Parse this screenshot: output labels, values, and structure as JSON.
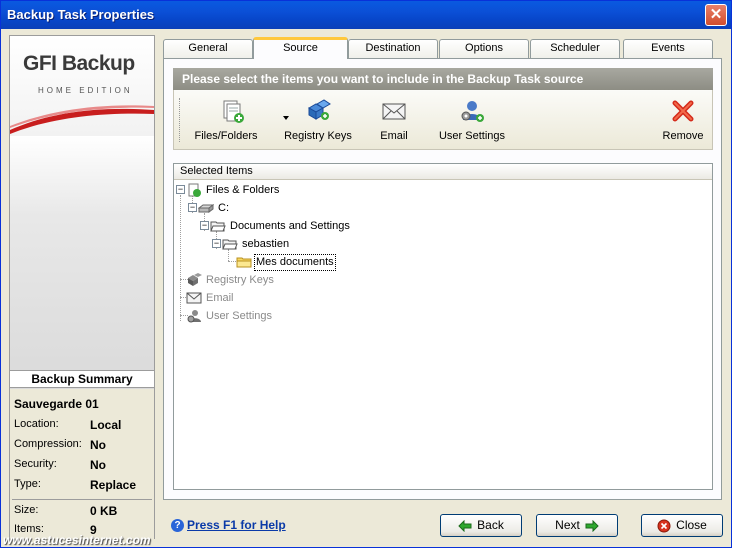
{
  "window": {
    "title": "Backup Task Properties",
    "close_glyph": "✕"
  },
  "logo": {
    "brand": "GFI Backup",
    "edition": "HOME EDITION"
  },
  "summary": {
    "header": "Backup Summary",
    "name": "Sauvegarde 01",
    "rows": [
      {
        "key": "Location:",
        "value": "Local"
      },
      {
        "key": "Compression:",
        "value": "No"
      },
      {
        "key": "Security:",
        "value": "No"
      },
      {
        "key": "Type:",
        "value": "Replace"
      },
      {
        "key": "Size:",
        "value": "0 KB"
      },
      {
        "key": "Items:",
        "value": "9"
      }
    ]
  },
  "tabs": [
    "General",
    "Source",
    "Destination",
    "Options",
    "Scheduler",
    "Events"
  ],
  "active_tab": "Source",
  "banner": "Please select the items you want to include in the Backup Task source",
  "toolbar": {
    "files_folders": "Files/Folders",
    "registry_keys": "Registry Keys",
    "email": "Email",
    "user_settings": "User Settings",
    "remove": "Remove"
  },
  "tree": {
    "header": "Selected Items",
    "nodes": {
      "files_folders": "Files & Folders",
      "drive_c": "C:",
      "docs_settings": "Documents and Settings",
      "sebastien": "sebastien",
      "mes_documents": "Mes documents",
      "registry_keys": "Registry Keys",
      "email": "Email",
      "user_settings": "User Settings"
    }
  },
  "footer": {
    "help": "Press F1 for Help",
    "back": "Back",
    "next": "Next",
    "close": "Close"
  },
  "watermark": "www.astucesinternet.com",
  "colors": {
    "title_bar": "#0b4fd6",
    "banner": "#8d8d84",
    "active_tab_accent": "#ffc83c",
    "help_link": "#0a3aa8"
  }
}
